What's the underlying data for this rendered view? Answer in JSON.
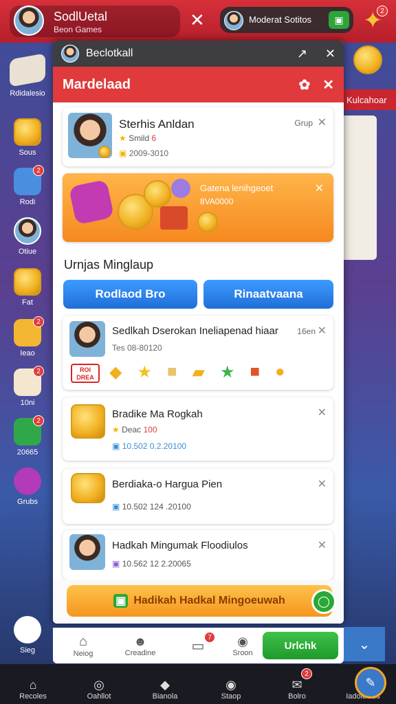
{
  "topbar": {
    "name": "SodlUetal",
    "sub": "Beon Games",
    "mid_label": "Moderat Sotitos"
  },
  "side": {
    "left_top_label": "Rdidalesio",
    "items": [
      "Sous",
      "Rodi",
      "Otiue",
      "Fat",
      "Ieao",
      "10ni",
      "20665",
      "Grubs",
      "Sieg"
    ],
    "badges": [
      "2",
      "2",
      "2",
      "2"
    ],
    "right_banner": "Kulcahoar"
  },
  "modal": {
    "title": "Beclotkall",
    "redbar_title": "Mardelaad",
    "profile": {
      "name": "Sterhis Anldan",
      "level_label": "Smild",
      "level_value": "6",
      "date": "2009-3010",
      "group": "Grup"
    },
    "promo": {
      "title": "Gatena lenihgeoet",
      "sub": "8VA0000"
    },
    "section_title": "Urnjas Minglaup",
    "btn_left": "Rodlaod Bro",
    "btn_right": "Rinaatvaana",
    "items": [
      {
        "title": "Sedlkah Dserokan Ineliapenad hiaar",
        "date": "Tes 08-80120",
        "time": "16en",
        "promo_tag": "ROI\nDREA"
      },
      {
        "title": "Bradike Ma Rogkah",
        "level_label": "Deac",
        "level_value": "100",
        "date": "10.502 0.2.20100"
      },
      {
        "title": "Berdiaka‑o Hargua Pien",
        "date": "10.502 124 .20100"
      },
      {
        "title": "Hadkah Mingumak Floodiulos",
        "date": "10.562 12 2.20065"
      }
    ],
    "cta": "Hadikah Hadkal Mingoeuwah"
  },
  "subnav": {
    "items": [
      "Neiog",
      "Creadine",
      "",
      "Sroon"
    ],
    "cta": "Urlchk",
    "badge": "7"
  },
  "bottomnav": {
    "items": [
      "Recoles",
      "Oahllot",
      "Bianola",
      "Staop",
      "Bolro",
      "Iadolesies"
    ],
    "badge": "2"
  },
  "colors": {
    "red": "#e03a3c",
    "blue": "#1f6fd8",
    "green": "#2aa836",
    "orange": "#f5a623"
  }
}
